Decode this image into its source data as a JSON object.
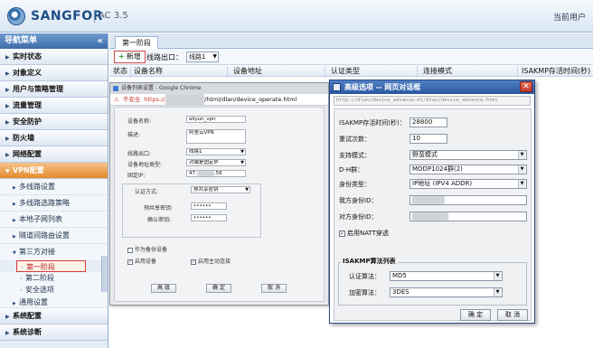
{
  "header": {
    "brand": "SANGFOR",
    "version": "AC 3.5",
    "current_user_label": "当前用户"
  },
  "sidebar": {
    "title": "导航菜单",
    "collapse_icon": "double-chevron-left-icon",
    "items": [
      {
        "label": "实时状态"
      },
      {
        "label": "对象定义"
      },
      {
        "label": "用户与策略管理"
      },
      {
        "label": "流量管理"
      },
      {
        "label": "安全防护"
      },
      {
        "label": "防火墙"
      },
      {
        "label": "网络配置"
      },
      {
        "label": "VPN配置"
      }
    ],
    "vpn_sub": [
      {
        "label": "多线路设置"
      },
      {
        "label": "多线路选路策略"
      },
      {
        "label": "本地子网列表"
      },
      {
        "label": "隧道间路由设置"
      },
      {
        "label": "第三方对接"
      }
    ],
    "third_party_leaves": [
      {
        "label": "第一阶段"
      },
      {
        "label": "第二阶段"
      },
      {
        "label": "安全选项"
      }
    ],
    "bottom_sub": {
      "label": "通用设置"
    },
    "bottom_items": [
      {
        "label": "系统配置"
      },
      {
        "label": "系统诊断"
      }
    ]
  },
  "main": {
    "tab": "第一阶段",
    "toolbar": {
      "add_label": "新增",
      "line_label": "线路出口：",
      "line_value": "线路1"
    },
    "columns": [
      "状态",
      "设备名称",
      "设备地址",
      "认证类型",
      "连接模式",
      "ISAKMP存活时间(秒)"
    ]
  },
  "chrome_popup": {
    "window_title": "设备列表设置 - Google Chrome",
    "insecure_label": "不安全",
    "url_scheme": "https://",
    "url_path": "/html/dlan/device_operate.html",
    "form": {
      "device_name_label": "设备名称:",
      "device_name_value": "aliyun_vpn",
      "desc_label": "描述:",
      "desc_value": "阿里云VPN",
      "line_label": "线路出口:",
      "line_value": "线路1",
      "addr_type_label": "设备地址类型:",
      "addr_type_value": "对端是固定IP",
      "fixed_ip_label": "固定IP:",
      "fixed_ip_value": "47.",
      "fixed_ip_tail": ".56",
      "auth_method_label": "认证方式:",
      "auth_method_value": "预共享密钥",
      "psk_label": "预共享密钥:",
      "psk_value": "••••••",
      "psk_confirm_label": "确认密钥:",
      "psk_confirm_value": "••••••",
      "backup_label": "作为备份设备",
      "enable_label": "启用设备",
      "active_conn_label": "启用主动连接",
      "btn_advanced": "高 级",
      "btn_ok": "确 定",
      "btn_cancel": "取 消"
    }
  },
  "adv_dialog": {
    "title": "高级选项 -- 网页对话框",
    "url": "http://dlan/device_advance.ml/dlan/device_advance.html",
    "close_icon": "close-icon",
    "fields": {
      "isakmp_label": "ISAKMP存活时间(秒)：",
      "isakmp_value": "28800",
      "retry_label": "重试次数：",
      "retry_value": "10",
      "mode_label": "支持模式：",
      "mode_value": "野蛮模式",
      "dh_label": "D-H群：",
      "dh_value": "MODP1024群(2)",
      "id_type_label": "身份类型：",
      "id_type_value": "IP地址 (IPV4 ADDR)",
      "local_id_label": "我方身份ID：",
      "peer_id_label": "对方身份ID：",
      "natt_label": "启用NATT穿透"
    },
    "algo": {
      "legend": "ISAKMP算法列表",
      "auth_label": "认证算法：",
      "auth_value": "MD5",
      "enc_label": "加密算法：",
      "enc_value": "3DES"
    },
    "btn_ok": "确 定",
    "btn_cancel": "取 消"
  }
}
